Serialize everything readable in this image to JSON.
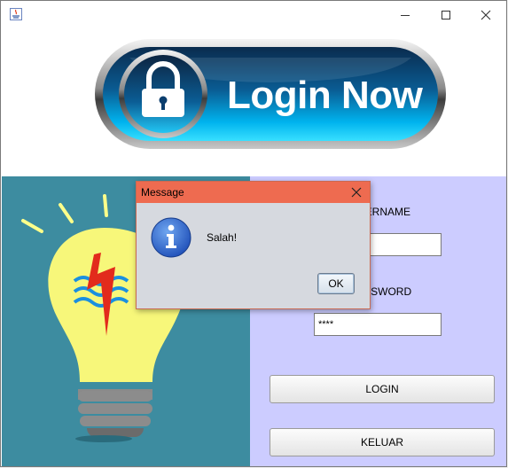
{
  "window": {
    "title": "",
    "minimize_icon": "minimize-icon",
    "maximize_icon": "maximize-icon",
    "close_icon": "close-icon"
  },
  "banner": {
    "text": "Login Now",
    "icon": "lock-icon"
  },
  "illustration": {
    "icon": "light-bulb-icon"
  },
  "form": {
    "username_label": "USERNAME",
    "username_value": "",
    "password_label": "PASSWORD",
    "password_value": "****",
    "login_label": "LOGIN",
    "exit_label": "KELUAR"
  },
  "dialog": {
    "title": "Message",
    "message": "Salah!",
    "ok_label": "OK",
    "icon": "information-icon"
  },
  "colors": {
    "left_panel": "#3d8ca0",
    "right_panel": "#ccccff",
    "dialog_title": "#ee6b50",
    "banner_blue": "#00aee8"
  }
}
